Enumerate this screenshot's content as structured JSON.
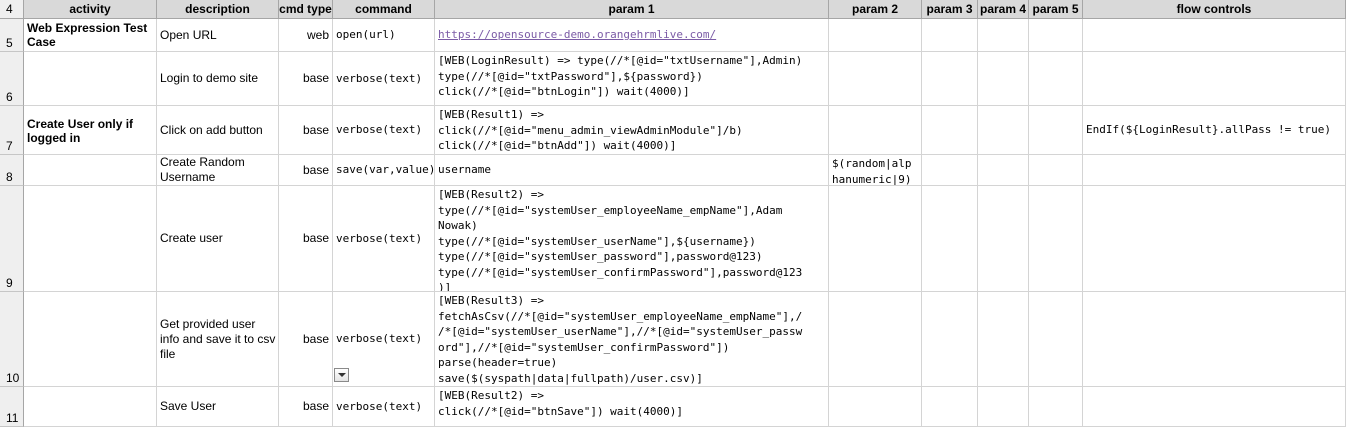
{
  "headers": {
    "row_header": "4",
    "activity": "activity",
    "description": "description",
    "cmd_type": "cmd type",
    "command": "command",
    "param1": "param 1",
    "param2": "param 2",
    "param3": "param 3",
    "param4": "param 4",
    "param5": "param 5",
    "flow_controls": "flow controls"
  },
  "rows": [
    {
      "num": "5",
      "activity": "Web Expression Test Case",
      "description": "Open URL",
      "cmd_type": "web",
      "command": "open(url)",
      "param1": [
        "https://opensource-demo.orangehrmlive.com/"
      ],
      "param2": [],
      "flow": ""
    },
    {
      "num": "6",
      "activity": "",
      "description": "Login to demo site",
      "cmd_type": "base",
      "command": "verbose(text)",
      "param1": [
        "[WEB(LoginResult) => type(//*[@id=\"txtUsername\"],Admin)",
        "type(//*[@id=\"txtPassword\"],${password})",
        "click(//*[@id=\"btnLogin\"]) wait(4000)]"
      ],
      "param2": [],
      "flow": ""
    },
    {
      "num": "7",
      "activity": "Create User only if logged in",
      "description": "Click on add button",
      "cmd_type": "base",
      "command": "verbose(text)",
      "param1": [
        "[WEB(Result1) =>",
        "click(//*[@id=\"menu_admin_viewAdminModule\"]/b)",
        "click(//*[@id=\"btnAdd\"]) wait(4000)]"
      ],
      "param2": [],
      "flow": "EndIf(${LoginResult}.allPass != true)"
    },
    {
      "num": "8",
      "activity": "",
      "description": "Create Random Username",
      "cmd_type": "base",
      "command": "save(var,value)",
      "param1": [
        "username"
      ],
      "param2": [
        "$(random|alp",
        "hanumeric|9)"
      ],
      "flow": ""
    },
    {
      "num": "9",
      "activity": "",
      "description": "Create user",
      "cmd_type": "base",
      "command": "verbose(text)",
      "param1": [
        "[WEB(Result2) =>",
        "type(//*[@id=\"systemUser_employeeName_empName\"],Adam",
        "Nowak)",
        "type(//*[@id=\"systemUser_userName\"],${username})",
        "type(//*[@id=\"systemUser_password\"],password@123)",
        "type(//*[@id=\"systemUser_confirmPassword\"],password@123",
        ")]"
      ],
      "param2": [],
      "flow": ""
    },
    {
      "num": "10",
      "activity": "",
      "description": "Get provided user info and save it to csv file",
      "cmd_type": "base",
      "command": "verbose(text)",
      "param1": [
        "[WEB(Result3) =>",
        "fetchAsCsv(//*[@id=\"systemUser_employeeName_empName\"],/",
        "/*[@id=\"systemUser_userName\"],//*[@id=\"systemUser_passw",
        "ord\"],//*[@id=\"systemUser_confirmPassword\"])",
        "parse(header=true)",
        "save($(syspath|data|fullpath)/user.csv)]"
      ],
      "param2": [],
      "flow": ""
    },
    {
      "num": "11",
      "activity": "",
      "description": "Save User",
      "cmd_type": "base",
      "command": "verbose(text)",
      "param1": [
        "[WEB(Result2) =>",
        "click(//*[@id=\"btnSave\"]) wait(4000)]"
      ],
      "param2": [],
      "flow": ""
    }
  ],
  "icons": {
    "dropdown": "dropdown-arrow-icon"
  }
}
